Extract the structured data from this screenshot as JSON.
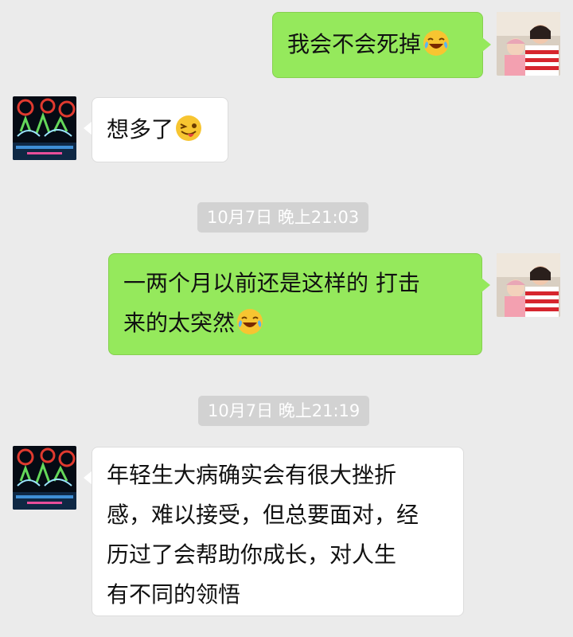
{
  "messages": [
    {
      "direction": "outgoing",
      "text": "我会不会死掉",
      "emoji": "crying-laughing-emoji",
      "avatar": "avatar-woman-with-baby"
    },
    {
      "direction": "incoming",
      "text": "想多了",
      "emoji": "winking-tongue-emoji",
      "avatar": "avatar-fireworks-night"
    },
    {
      "type": "timestamp",
      "text": "10月7日 晚上21:03"
    },
    {
      "direction": "outgoing",
      "lines": [
        "一两个月以前还是这样的 打击",
        "来的太突然"
      ],
      "emoji": "crying-laughing-emoji",
      "avatar": "avatar-woman-with-baby"
    },
    {
      "type": "timestamp",
      "text": "10月7日 晚上21:19"
    },
    {
      "direction": "incoming",
      "lines": [
        "年轻生大病确实会有很大挫折",
        "感，难以接受，但总要面对，经",
        "历过了会帮助你成长，对人生",
        "有不同的领悟"
      ],
      "avatar": "avatar-fireworks-night"
    }
  ],
  "colors": {
    "background": "#ebebeb",
    "outgoing_bubble": "#95e95c",
    "incoming_bubble": "#ffffff",
    "timestamp_pill": "#d2d2d2"
  }
}
